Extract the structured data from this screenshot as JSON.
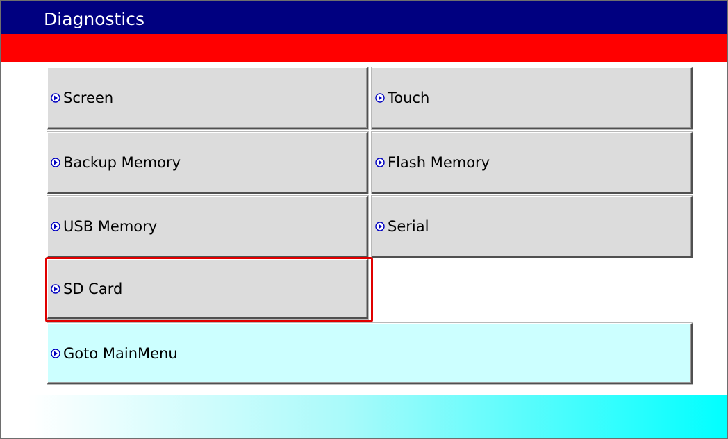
{
  "window": {
    "title": "Diagnostics"
  },
  "colors": {
    "title_bar": "#000080",
    "banner": "#ff0000",
    "button_face": "#dcdcdc",
    "goto_button_face": "#ccffff",
    "selection_border": "#e00000",
    "footer_gradient_end": "#00ffff"
  },
  "menu": {
    "items": [
      {
        "id": "screen",
        "label": "Screen",
        "icon": "circle-arrow-right-icon"
      },
      {
        "id": "touch",
        "label": "Touch",
        "icon": "circle-arrow-right-icon"
      },
      {
        "id": "backup_memory",
        "label": "Backup Memory",
        "icon": "circle-arrow-right-icon"
      },
      {
        "id": "flash_memory",
        "label": "Flash Memory",
        "icon": "circle-arrow-right-icon"
      },
      {
        "id": "usb_memory",
        "label": "USB Memory",
        "icon": "circle-arrow-right-icon"
      },
      {
        "id": "serial",
        "label": "Serial",
        "icon": "circle-arrow-right-icon"
      },
      {
        "id": "sd_card",
        "label": "SD Card",
        "icon": "circle-arrow-right-icon",
        "selected": true
      }
    ],
    "goto_main": {
      "label": "Goto MainMenu",
      "icon": "circle-arrow-right-icon"
    }
  }
}
